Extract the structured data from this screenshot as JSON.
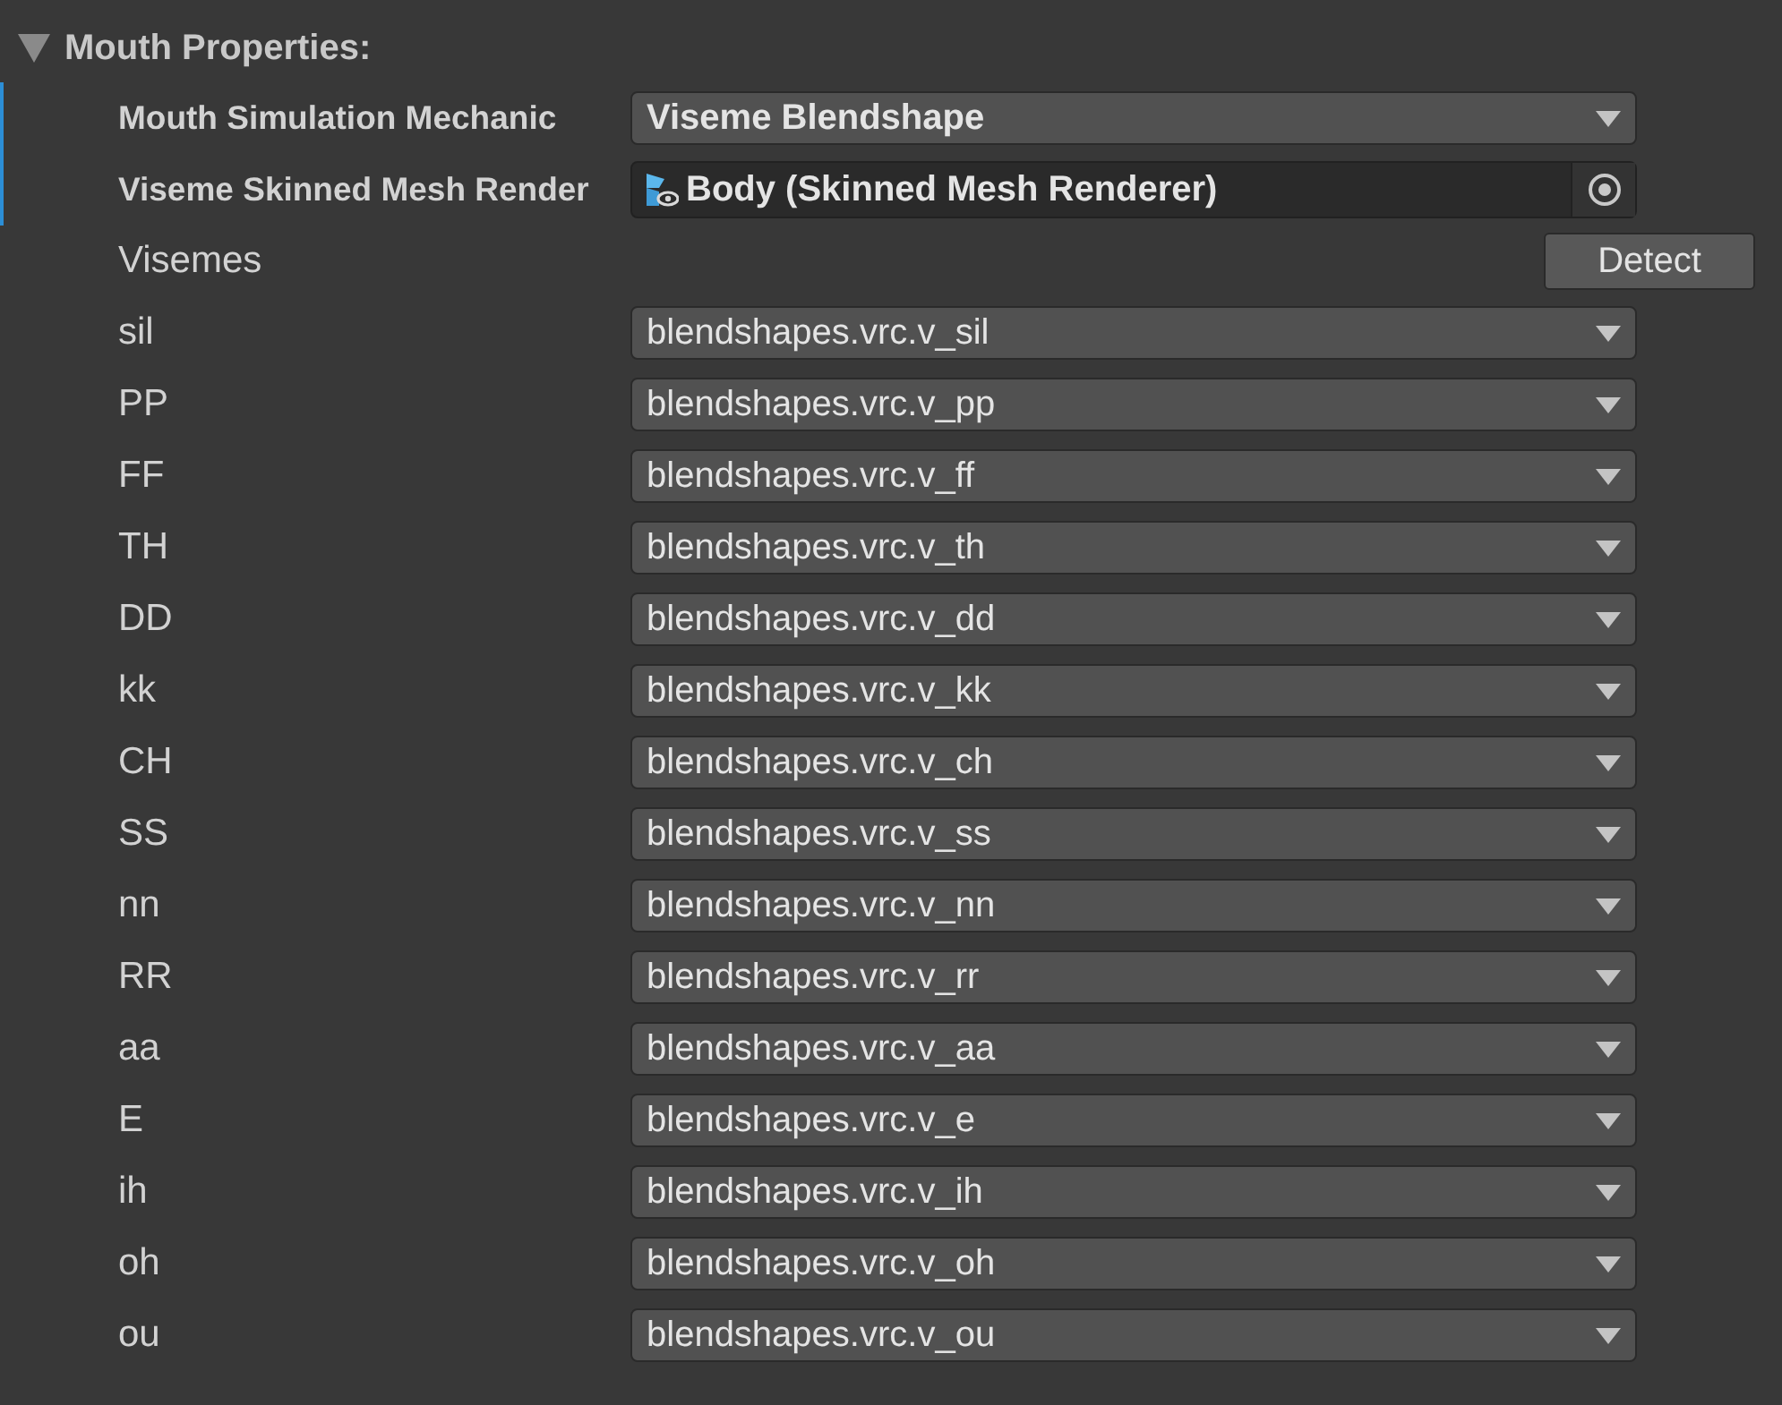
{
  "section": {
    "title": "Mouth Properties:",
    "expanded": true
  },
  "properties": [
    {
      "kind": "dropdown",
      "label": "Mouth Simulation Mechanic",
      "value": "Viseme Blendshape",
      "modified": true
    },
    {
      "kind": "object",
      "label": "Viseme Skinned Mesh Render",
      "value": "Body (Skinned Mesh Renderer)",
      "modified": true
    }
  ],
  "visemes": {
    "label": "Visemes",
    "button": "Detect",
    "rows": [
      {
        "label": "sil",
        "value": "blendshapes.vrc.v_sil"
      },
      {
        "label": "PP",
        "value": "blendshapes.vrc.v_pp"
      },
      {
        "label": "FF",
        "value": "blendshapes.vrc.v_ff"
      },
      {
        "label": "TH",
        "value": "blendshapes.vrc.v_th"
      },
      {
        "label": "DD",
        "value": "blendshapes.vrc.v_dd"
      },
      {
        "label": "kk",
        "value": "blendshapes.vrc.v_kk"
      },
      {
        "label": "CH",
        "value": "blendshapes.vrc.v_ch"
      },
      {
        "label": "SS",
        "value": "blendshapes.vrc.v_ss"
      },
      {
        "label": "nn",
        "value": "blendshapes.vrc.v_nn"
      },
      {
        "label": "RR",
        "value": "blendshapes.vrc.v_rr"
      },
      {
        "label": "aa",
        "value": "blendshapes.vrc.v_aa"
      },
      {
        "label": "E",
        "value": "blendshapes.vrc.v_e"
      },
      {
        "label": "ih",
        "value": "blendshapes.vrc.v_ih"
      },
      {
        "label": "oh",
        "value": "blendshapes.vrc.v_oh"
      },
      {
        "label": "ou",
        "value": "blendshapes.vrc.v_ou"
      }
    ]
  }
}
